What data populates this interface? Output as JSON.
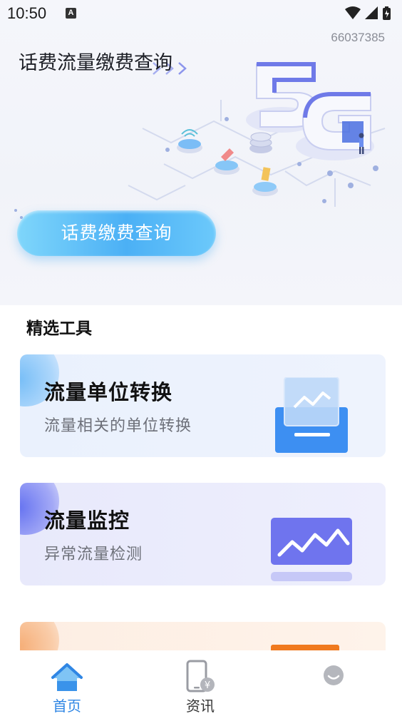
{
  "status_bar": {
    "time": "10:50",
    "notification_icon": "A",
    "icons": [
      "wifi-icon",
      "cell-signal-icon",
      "battery-icon"
    ]
  },
  "hero": {
    "id_number": "66037385",
    "title": "话费流量缴费查询",
    "button_label": "话费缴费查询",
    "art": "5G-isometric-illustration"
  },
  "section": {
    "title": "精选工具"
  },
  "cards": [
    {
      "title": "流量单位转换",
      "subtitle": "流量相关的单位转换",
      "icon": "document-chart-icon",
      "accent": "#3d8ff2"
    },
    {
      "title": "流量监控",
      "subtitle": "异常流量检测",
      "icon": "monitor-chart-icon",
      "accent": "#6f74ee"
    },
    {
      "title": "",
      "subtitle": "",
      "icon": "orange-tool-icon",
      "accent": "#f07a1e"
    }
  ],
  "bottom_nav": {
    "items": [
      {
        "label": "首页",
        "icon": "home-icon",
        "active": true
      },
      {
        "label": "资讯",
        "icon": "phone-yen-icon",
        "active": false
      },
      {
        "label": "",
        "icon": "profile-icon",
        "active": false
      }
    ],
    "active_color": "#2f86e4"
  }
}
